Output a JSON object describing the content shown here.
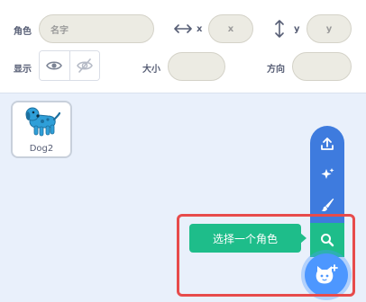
{
  "sprite_info": {
    "sprite_label": "角色",
    "name_placeholder": "名字",
    "x_label": "x",
    "x_placeholder": "x",
    "y_label": "y",
    "y_placeholder": "y",
    "show_label": "显示",
    "size_label": "大小",
    "size_value": "",
    "direction_label": "方向",
    "direction_value": ""
  },
  "sprites": [
    {
      "name": "Dog2"
    }
  ],
  "add_menu": {
    "tooltip": "选择一个角色",
    "items": [
      "upload-icon",
      "surprise-icon",
      "paint-icon",
      "search-icon"
    ],
    "main_icon": "sprite-icon"
  },
  "colors": {
    "menu_blue": "#3e7bde",
    "search_green": "#1ebd8a",
    "main_button_blue": "#4d97ff",
    "highlight_red": "#e74b4b",
    "sprite_area_bg": "#e9f0fb"
  }
}
